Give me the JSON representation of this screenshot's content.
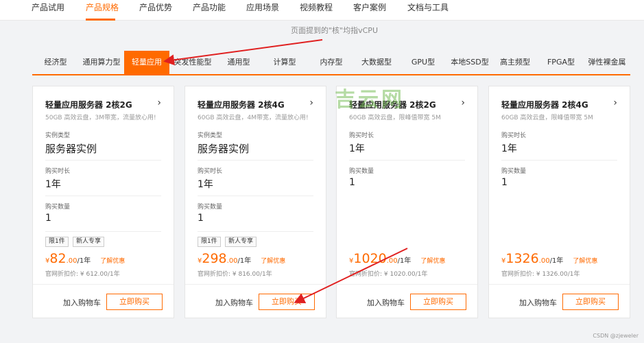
{
  "topnav": {
    "items": [
      "产品试用",
      "产品规格",
      "产品优势",
      "产品功能",
      "应用场景",
      "视频教程",
      "客户案例",
      "文档与工具"
    ],
    "active_index": 1
  },
  "note": "页面提到的\"核\"均指vCPU",
  "tabs": {
    "items": [
      "经济型",
      "通用算力型",
      "轻量应用",
      "突发性能型",
      "通用型",
      "计算型",
      "内存型",
      "大数据型",
      "GPU型",
      "本地SSD型",
      "高主频型",
      "FPGA型",
      "弹性裸金属"
    ],
    "active_index": 2
  },
  "cards": [
    {
      "title": "轻量应用服务器 2核2G",
      "subtitle": "50GB 高效云盘，3M带宽，流量放心用!",
      "instance_label": "实例类型",
      "instance_value": "服务器实例",
      "duration_label": "购买时长",
      "duration_value": "1年",
      "qty_label": "购买数量",
      "qty_value": "1",
      "tags": [
        "限1件",
        "新人专享"
      ],
      "price_currency": "¥",
      "price_int": "82",
      "price_dec": ".00",
      "price_unit": "/1年",
      "discount_link": "了解优惠",
      "original": "官网折扣价: ¥ 612.00/1年",
      "cart_label": "加入购物车",
      "buy_label": "立即购买"
    },
    {
      "title": "轻量应用服务器 2核4G",
      "subtitle": "60GB 高效云盘，4M带宽，流量放心用!",
      "instance_label": "实例类型",
      "instance_value": "服务器实例",
      "duration_label": "购买时长",
      "duration_value": "1年",
      "qty_label": "购买数量",
      "qty_value": "1",
      "tags": [
        "限1件",
        "新人专享"
      ],
      "price_currency": "¥",
      "price_int": "298",
      "price_dec": ".00",
      "price_unit": "/1年",
      "discount_link": "了解优惠",
      "original": "官网折扣价: ¥ 816.00/1年",
      "cart_label": "加入购物车",
      "buy_label": "立即购买"
    },
    {
      "title": "轻量应用服务器 2核2G",
      "subtitle": "60GB 高效云盘，限峰值带宽 5M",
      "duration_label": "购买时长",
      "duration_value": "1年",
      "qty_label": "购买数量",
      "qty_value": "1",
      "price_currency": "¥",
      "price_int": "1020",
      "price_dec": ".00",
      "price_unit": "/1年",
      "discount_link": "了解优惠",
      "original": "官网折扣价: ¥ 1020.00/1年",
      "cart_label": "加入购物车",
      "buy_label": "立即购买"
    },
    {
      "title": "轻量应用服务器 2核4G",
      "subtitle": "60GB 高效云盘，限峰值带宽 5M",
      "duration_label": "购买时长",
      "duration_value": "1年",
      "qty_label": "购买数量",
      "qty_value": "1",
      "price_currency": "¥",
      "price_int": "1326",
      "price_dec": ".00",
      "price_unit": "/1年",
      "discount_link": "了解优惠",
      "original": "官网折扣价: ¥ 1326.00/1年",
      "cart_label": "加入购物车",
      "buy_label": "立即购买"
    }
  ],
  "watermark": "吉云网",
  "credit": "CSDN @zjeweler",
  "colors": {
    "accent": "#ff6a00",
    "annotation": "#e02020"
  }
}
